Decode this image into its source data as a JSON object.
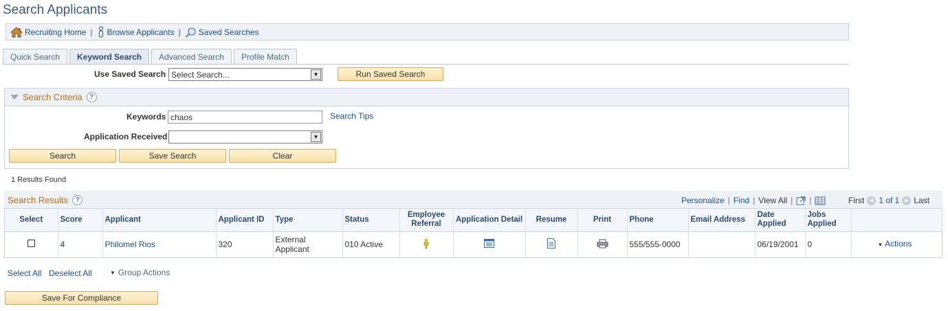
{
  "page": {
    "title": "Search Applicants"
  },
  "navbar": {
    "items": [
      {
        "label": "Recruiting Home",
        "icon": "home-icon"
      },
      {
        "label": "Browse Applicants",
        "icon": "person-icon"
      },
      {
        "label": "Saved Searches",
        "icon": "magnifier-icon"
      }
    ],
    "separator": "|"
  },
  "tabs": [
    {
      "label": "Quick Search",
      "active": false
    },
    {
      "label": "Keyword Search",
      "active": true
    },
    {
      "label": "Advanced Search",
      "active": false
    },
    {
      "label": "Profile Match",
      "active": false
    }
  ],
  "saved_search": {
    "label": "Use Saved Search",
    "value": "Select Search...",
    "run_button": "Run Saved Search"
  },
  "criteria": {
    "title": "Search Criteria",
    "help": "?",
    "keywords_label": "Keywords",
    "keywords_value": "chaos",
    "search_tips": "Search Tips",
    "app_received_label": "Application Received",
    "app_received_value": "",
    "buttons": {
      "search": "Search",
      "save": "Save Search",
      "clear": "Clear"
    }
  },
  "results": {
    "count_text": "1 Results Found",
    "title": "Search Results",
    "help": "?",
    "toolbar": {
      "personalize": "Personalize",
      "find": "Find",
      "view_all": "View All",
      "first": "First",
      "range": "1 of 1",
      "last": "Last"
    },
    "columns": [
      "Select",
      "Score",
      "Applicant",
      "Applicant ID",
      "Type",
      "Status",
      "Employee Referral",
      "Application Detail",
      "Resume",
      "Print",
      "Phone",
      "Email Address",
      "Date Applied",
      "Jobs Applied",
      ""
    ],
    "rows": [
      {
        "score": "4",
        "applicant": "Philomel Rios",
        "applicant_id": "320",
        "type": "External Applicant",
        "status": "010 Active",
        "phone": "555/555-0000",
        "email": "",
        "date_applied": "06/19/2001",
        "jobs_applied": "0",
        "actions": "Actions"
      }
    ]
  },
  "bottom": {
    "select_all": "Select All",
    "deselect_all": "Deselect All",
    "group_actions": "Group Actions",
    "compliance_button": "Save For Compliance"
  },
  "colors": {
    "accent_orange": "#c26b1e",
    "link_blue": "#1a4f8b",
    "button_gold": "#f7dfa8"
  }
}
